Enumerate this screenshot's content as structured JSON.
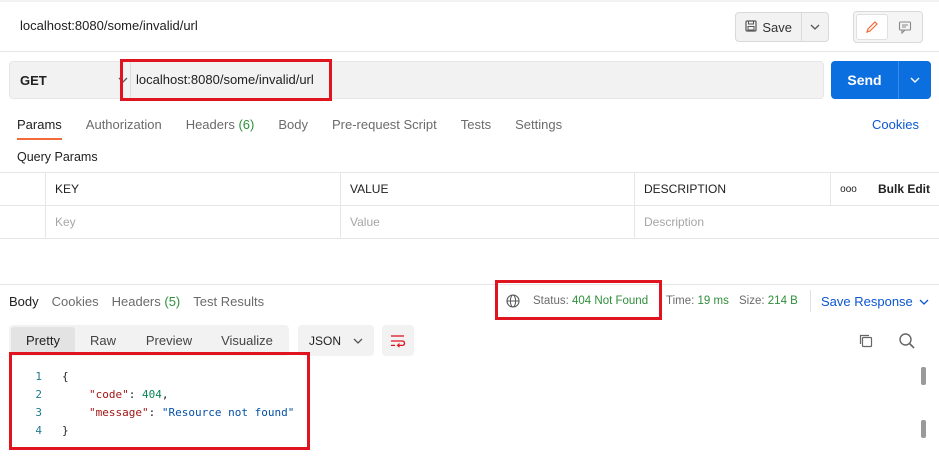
{
  "request": {
    "title": "localhost:8080/some/invalid/url",
    "method": "GET",
    "url": "localhost:8080/some/invalid/url",
    "save_label": "Save",
    "send_label": "Send"
  },
  "request_tabs": [
    {
      "label": "Params",
      "count": ""
    },
    {
      "label": "Authorization",
      "count": ""
    },
    {
      "label": "Headers",
      "count": "(6)"
    },
    {
      "label": "Body",
      "count": ""
    },
    {
      "label": "Pre-request Script",
      "count": ""
    },
    {
      "label": "Tests",
      "count": ""
    },
    {
      "label": "Settings",
      "count": ""
    }
  ],
  "cookies_label": "Cookies",
  "query_params": {
    "title": "Query Params",
    "headers": {
      "key": "KEY",
      "value": "VALUE",
      "description": "DESCRIPTION",
      "more": "ooo",
      "bulk_edit": "Bulk Edit"
    },
    "placeholders": {
      "key": "Key",
      "value": "Value",
      "description": "Description"
    }
  },
  "response": {
    "tabs": [
      {
        "label": "Body",
        "count": ""
      },
      {
        "label": "Cookies",
        "count": ""
      },
      {
        "label": "Headers",
        "count": "(5)"
      },
      {
        "label": "Test Results",
        "count": ""
      }
    ],
    "status_label": "Status:",
    "status_value": "404 Not Found",
    "time_label": "Time:",
    "time_value": "19 ms",
    "size_label": "Size:",
    "size_value": "214 B",
    "save_response_label": "Save Response",
    "formats": [
      "Pretty",
      "Raw",
      "Preview",
      "Visualize"
    ],
    "language": "JSON",
    "body_lines": [
      {
        "n": "1",
        "open": "{"
      },
      {
        "n": "2",
        "key": "\"code\"",
        "value": "404",
        "trail": ","
      },
      {
        "n": "3",
        "key": "\"message\"",
        "value": "\"Resource not found\"",
        "trail": ""
      },
      {
        "n": "4",
        "close": "}"
      }
    ]
  },
  "colors": {
    "accent_send": "#0c6fe0",
    "highlight_red": "#e0141e",
    "status_green": "#2f8f3b",
    "tab_underline": "#f26b3a"
  }
}
